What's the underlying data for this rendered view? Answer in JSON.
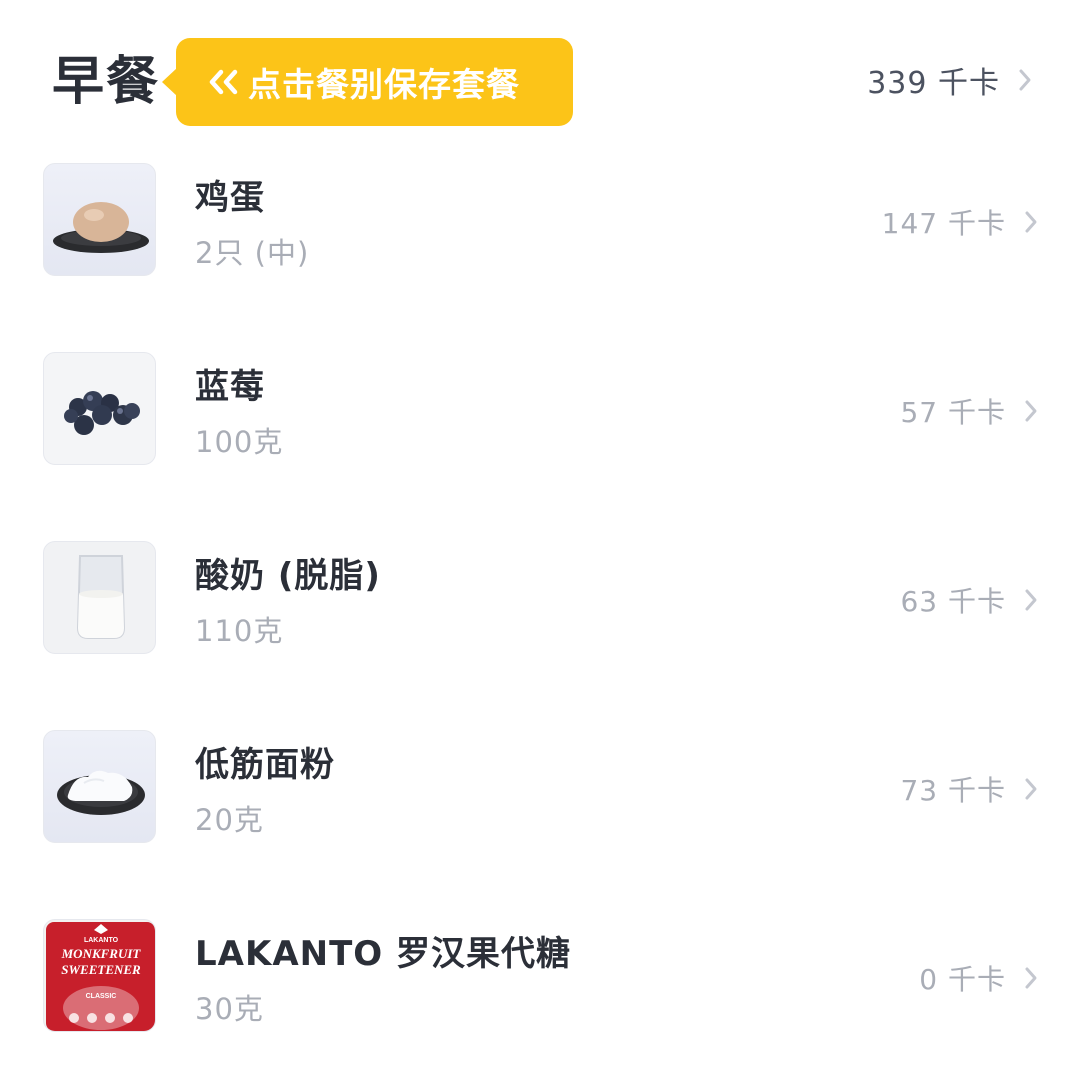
{
  "meal": {
    "title": "早餐",
    "tooltip_text": "点击餐别保存套餐",
    "tooltip_icon": "double-chevron-left-icon",
    "total_calories": "339 千卡"
  },
  "colors": {
    "tooltip_bg": "#fcc418",
    "title_text": "#2b2f38",
    "secondary_text": "#a9adb6"
  },
  "foods": [
    {
      "name": "鸡蛋",
      "quantity": "2只 (中)",
      "calories": "147 千卡",
      "image": "egg-on-plate"
    },
    {
      "name": "蓝莓",
      "quantity": "100克",
      "calories": "57 千卡",
      "image": "blueberries"
    },
    {
      "name": "酸奶 (脱脂)",
      "quantity": "110克",
      "calories": "63 千卡",
      "image": "yogurt-glass"
    },
    {
      "name": "低筋面粉",
      "quantity": "20克",
      "calories": "73 千卡",
      "image": "flour-on-plate"
    },
    {
      "name": "LAKANTO 罗汉果代糖",
      "quantity": "30克",
      "calories": "0 千卡",
      "image": "lakanto-package",
      "package_text": [
        "LAKANTO",
        "MONKFRUIT",
        "SWEETENER",
        "CLASSIC"
      ]
    }
  ]
}
